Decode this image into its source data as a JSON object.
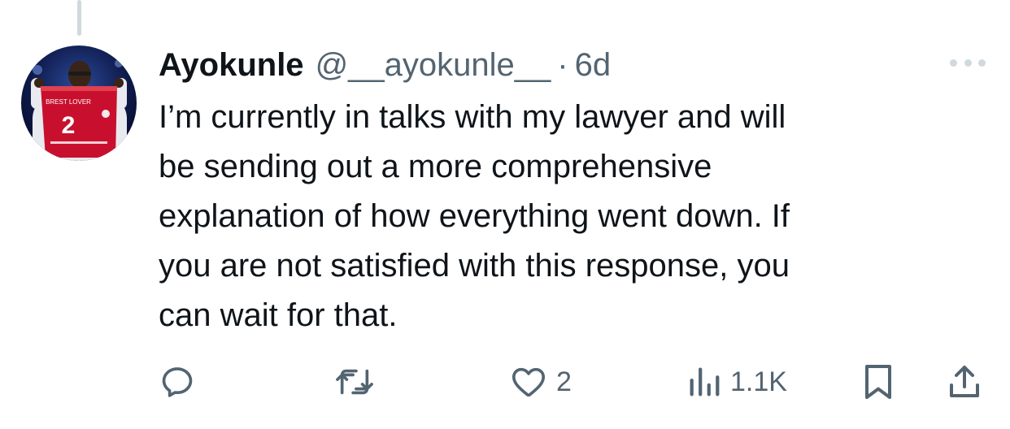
{
  "tweet": {
    "author_name": "Ayokunle",
    "handle": "@__ayokunle__",
    "separator": "·",
    "time": "6d",
    "text_lines": [
      "I’m currently in talks with my lawyer and will",
      "be sending out a more comprehensive",
      "explanation of how everything went down. If",
      "you are not satisfied with this response, you",
      "can wait for that."
    ],
    "avatar": {
      "shirt_text": "BREST LOVER",
      "shirt_number": "2"
    }
  },
  "actions": {
    "reply_count": "",
    "retweet_count": "",
    "like_count": "2",
    "views_count": "1.1K"
  },
  "colors": {
    "text": "#0f1419",
    "secondary": "#536471",
    "thread_line": "#cfd9de",
    "jersey_red": "#c8102e"
  },
  "icons": [
    "more-icon",
    "reply-icon",
    "retweet-icon",
    "like-icon",
    "views-icon",
    "bookmark-icon",
    "share-icon"
  ]
}
